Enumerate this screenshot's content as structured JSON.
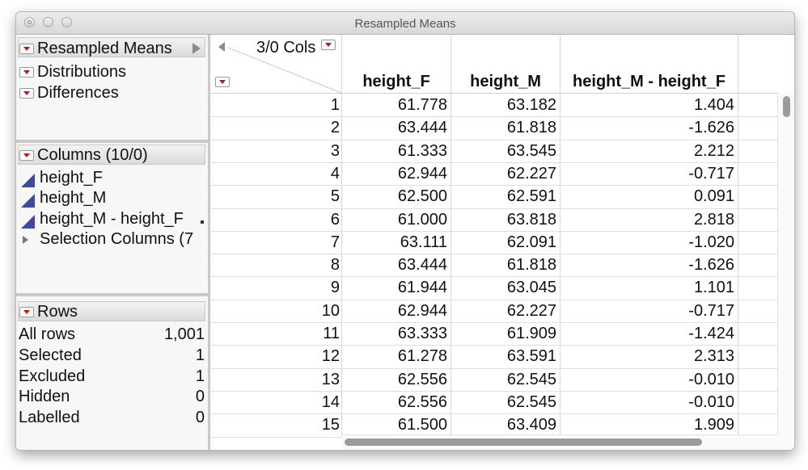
{
  "window": {
    "title": "Resampled Means"
  },
  "tables_panel": {
    "items": [
      {
        "label": "Resampled Means"
      },
      {
        "label": "Distributions"
      },
      {
        "label": "Differences"
      }
    ]
  },
  "columns_panel": {
    "header": "Columns (10/0)",
    "items": [
      {
        "label": "height_F"
      },
      {
        "label": "height_M"
      },
      {
        "label": "height_M - height_F"
      },
      {
        "label": "Selection Columns (7"
      }
    ]
  },
  "rows_panel": {
    "header": "Rows",
    "items": [
      {
        "label": "All rows",
        "value": "1,001"
      },
      {
        "label": "Selected",
        "value": "1"
      },
      {
        "label": "Excluded",
        "value": "1"
      },
      {
        "label": "Hidden",
        "value": "0"
      },
      {
        "label": "Labelled",
        "value": "0"
      }
    ]
  },
  "grid": {
    "cols_indicator": "3/0 Cols",
    "columns": [
      "height_F",
      "height_M",
      "height_M - height_F"
    ],
    "rows": [
      [
        "1",
        "61.778",
        "63.182",
        "1.404"
      ],
      [
        "2",
        "63.444",
        "61.818",
        "-1.626"
      ],
      [
        "3",
        "61.333",
        "63.545",
        "2.212"
      ],
      [
        "4",
        "62.944",
        "62.227",
        "-0.717"
      ],
      [
        "5",
        "62.500",
        "62.591",
        "0.091"
      ],
      [
        "6",
        "61.000",
        "63.818",
        "2.818"
      ],
      [
        "7",
        "63.111",
        "62.091",
        "-1.020"
      ],
      [
        "8",
        "63.444",
        "61.818",
        "-1.626"
      ],
      [
        "9",
        "61.944",
        "63.045",
        "1.101"
      ],
      [
        "10",
        "62.944",
        "62.227",
        "-0.717"
      ],
      [
        "11",
        "63.333",
        "61.909",
        "-1.424"
      ],
      [
        "12",
        "61.278",
        "63.591",
        "2.313"
      ],
      [
        "13",
        "62.556",
        "62.545",
        "-0.010"
      ],
      [
        "14",
        "62.556",
        "62.545",
        "-0.010"
      ],
      [
        "15",
        "61.500",
        "63.409",
        "1.909"
      ]
    ]
  }
}
